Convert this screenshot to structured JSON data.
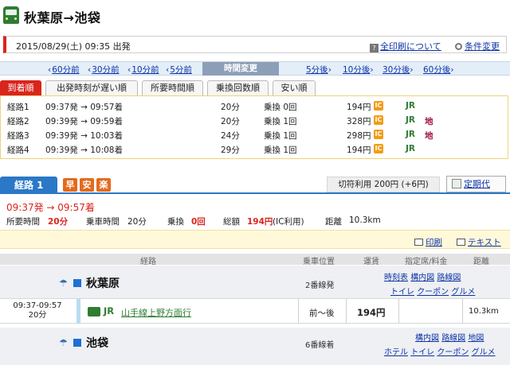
{
  "header": {
    "title": "秋葉原→池袋"
  },
  "search": {
    "datetime": "2015/08/29(土) 09:35 出発",
    "print_all": "全印刷について",
    "change_conditions": "条件変更"
  },
  "time_shift": {
    "back": [
      "60分前",
      "30分前",
      "10分前",
      "5分前"
    ],
    "center": "時間変更",
    "forward": [
      "5分後",
      "10分後",
      "30分後",
      "60分後"
    ]
  },
  "sort_tabs": [
    "到着順",
    "出発時刻が遅い順",
    "所要時間順",
    "乗換回数順",
    "安い順"
  ],
  "routes": [
    {
      "name": "経路1",
      "time": "09:37発 → 09:57着",
      "duration": "20分",
      "transfers": "乗換 0回",
      "fare": "194円",
      "ic": "IC",
      "lines": "JR",
      "subway": ""
    },
    {
      "name": "経路2",
      "time": "09:39発 → 09:59着",
      "duration": "20分",
      "transfers": "乗換 1回",
      "fare": "328円",
      "ic": "IC",
      "lines": "JR",
      "subway": "地"
    },
    {
      "name": "経路3",
      "time": "09:39発 → 10:03着",
      "duration": "24分",
      "transfers": "乗換 1回",
      "fare": "298円",
      "ic": "IC",
      "lines": "JR",
      "subway": "地"
    },
    {
      "name": "経路4",
      "time": "09:39発 → 10:08着",
      "duration": "29分",
      "transfers": "乗換 1回",
      "fare": "194円",
      "ic": "IC",
      "lines": "JR",
      "subway": ""
    }
  ],
  "route1": {
    "label": "経路 1",
    "badges": [
      {
        "text": "早",
        "color": "#e46a1d"
      },
      {
        "text": "安",
        "color": "#e46a1d"
      },
      {
        "text": "楽",
        "color": "#e46a1d"
      }
    ],
    "fare_note": "切符利用 200円 (+6円)",
    "commuter_pass": "定期代",
    "times": "09:37発 → 09:57着",
    "stats": {
      "total_time_label": "所要時間",
      "total_time": "20分",
      "ride_time_label": "乗車時間",
      "ride_time": "20分",
      "transfers_label": "乗換",
      "transfers": "0回",
      "fare_label": "総額",
      "fare": "194円",
      "fare_note": "(IC利用)",
      "distance_label": "距離",
      "distance": "10.3km"
    },
    "print": "印刷",
    "text": "テキスト"
  },
  "detail": {
    "headers": {
      "route": "経路",
      "position": "乗車位置",
      "fare": "運賃",
      "seat": "指定席/料金",
      "distance": "距離"
    },
    "from": {
      "name": "秋葉原",
      "track": "2番線発",
      "links1": [
        "時刻表",
        "構内図",
        "路線図"
      ],
      "links2": [
        "トイレ",
        "クーポン",
        "グルメ"
      ]
    },
    "segment": {
      "time": "09:37-09:57",
      "duration": "20分",
      "operator": "JR",
      "line": "山手線上野方面行",
      "position": "前〜後",
      "fare": "194円",
      "distance": "10.3km"
    },
    "to": {
      "name": "池袋",
      "track": "6番線着",
      "links1": [
        "構内図",
        "路線図",
        "地図"
      ],
      "links2": [
        "ホテル",
        "トイレ",
        "クーポン",
        "グルメ"
      ]
    }
  }
}
